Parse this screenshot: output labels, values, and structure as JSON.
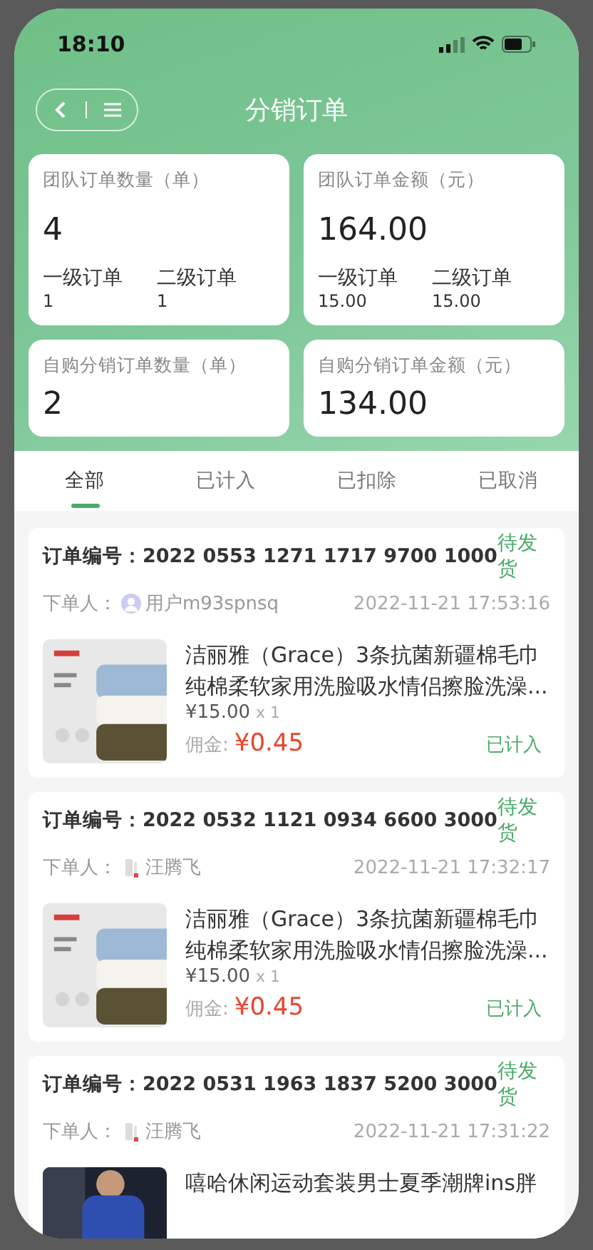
{
  "status_bar": {
    "time": "18:10"
  },
  "header": {
    "title": "分销订单"
  },
  "stats": [
    {
      "label": "团队订单数量（单）",
      "value": "4",
      "sub": [
        {
          "label": "一级订单",
          "value": "1"
        },
        {
          "label": "二级订单",
          "value": "1"
        }
      ]
    },
    {
      "label": "团队订单金额（元）",
      "value": "164.00",
      "sub": [
        {
          "label": "一级订单",
          "value": "15.00"
        },
        {
          "label": "二级订单",
          "value": "15.00"
        }
      ]
    },
    {
      "label": "自购分销订单数量（单）",
      "value": "2"
    },
    {
      "label": "自购分销订单金额（元）",
      "value": "134.00"
    }
  ],
  "tabs": [
    {
      "label": "全部",
      "selected": true
    },
    {
      "label": "已计入",
      "selected": false
    },
    {
      "label": "已扣除",
      "selected": false
    },
    {
      "label": "已取消",
      "selected": false
    }
  ],
  "orders": [
    {
      "number_label": "订单编号：",
      "number": "2022 0553 1271 1717 9700 1000",
      "status": "待发货",
      "buyer_label": "下单人：",
      "buyer": "用户m93spnsq",
      "avatar": {
        "kind": "default"
      },
      "time": "2022-11-21 17:53:16",
      "product": {
        "title": "洁丽雅（Grace）3条抗菌新疆棉毛巾纯棉柔软家用洗脸吸水情侣擦脸洗澡...",
        "price": "¥15.00",
        "qty": "x 1",
        "commission_label": "佣金:",
        "commission": "¥0.45",
        "settle_status": "已计入"
      }
    },
    {
      "number_label": "订单编号：",
      "number": "2022 0532 1121 0934 6600 3000",
      "status": "待发货",
      "buyer_label": "下单人：",
      "buyer": "汪腾飞",
      "time": "2022-11-21 17:32:17",
      "product": {
        "title": "洁丽雅（Grace）3条抗菌新疆棉毛巾纯棉柔软家用洗脸吸水情侣擦脸洗澡...",
        "price": "¥15.00",
        "qty": "x 1",
        "commission_label": "佣金:",
        "commission": "¥0.45",
        "settle_status": "已计入"
      }
    },
    {
      "number_label": "订单编号：",
      "number": "2022 0531 1963 1837 5200 3000",
      "status": "待发货",
      "buyer_label": "下单人：",
      "buyer": "汪腾飞",
      "time": "2022-11-21 17:31:22",
      "product": {
        "title": "嘻哈休闲运动套装男士夏季潮牌ins胖"
      }
    }
  ]
}
